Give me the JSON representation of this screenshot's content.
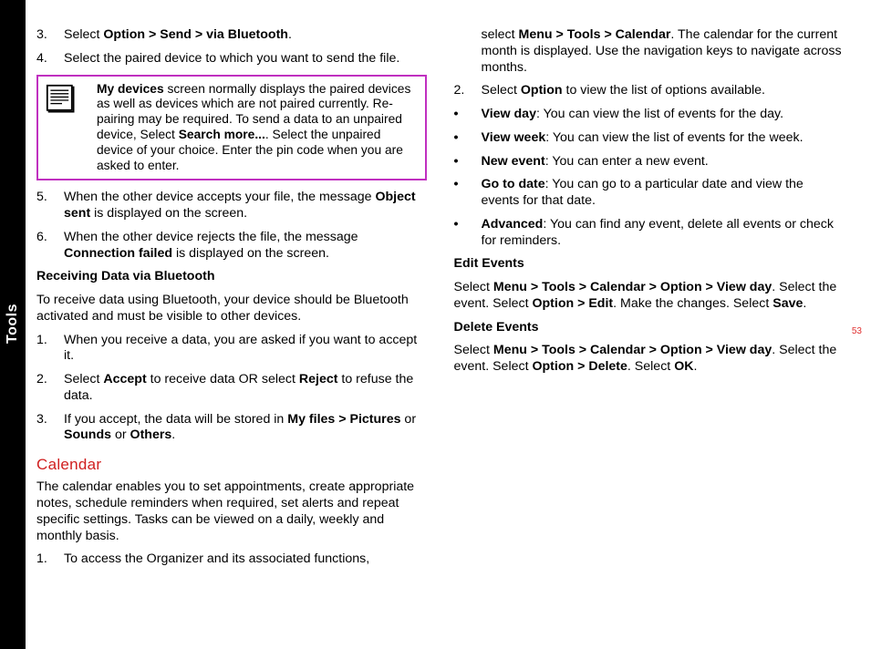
{
  "sideTab": "Tools",
  "pageNumber": "53",
  "col1": {
    "step3_num": "3.",
    "step3_a": "Select ",
    "step3_b": "Option > Send > via Bluetooth",
    "step3_c": ".",
    "step4_num": "4.",
    "step4": "Select the paired device to which you want to send the file.",
    "note_a": "My devices",
    "note_b": " screen normally displays the paired devices as well as devices which are not paired currently. Re-pairing may be required. To send a data to an unpaired device, Select ",
    "note_c": "Search more...",
    "note_d": ". Select the unpaired device of your choice. Enter the pin code when you are asked to enter.",
    "step5_num": "5.",
    "step5_a": "When the other device accepts your file, the message ",
    "step5_b": "Object sent",
    "step5_c": " is displayed on the screen.",
    "step6_num": "6.",
    "step6_a": "When the other device rejects the file, the message ",
    "step6_b": "Connection failed",
    "step6_c": " is displayed on the screen.",
    "recv_head": "Receiving Data via Bluetooth",
    "recv_intro": "To receive data using Bluetooth, your device should be Bluetooth activated and must be visible to other devices.",
    "r1_num": "1.",
    "r1": "When you receive a data, you are asked if you want to accept it.",
    "r2_num": "2.",
    "r2_a": "Select ",
    "r2_b": "Accept",
    "r2_c": " to receive data OR select ",
    "r2_d": "Reject",
    "r2_e": " to refuse the data.",
    "r3_num": "3.",
    "r3_a": "If you accept, the data will be stored in ",
    "r3_b": "My files > Pictures",
    "r3_c": " or ",
    "r3_d": "Sounds",
    "r3_e": " or ",
    "r3_f": "Others",
    "r3_g": ".",
    "cal_title": "Calendar",
    "cal_intro": "The calendar enables you to set appointments, create appropriate notes, schedule reminders when required, set alerts and repeat specific settings. Tasks can be viewed on a daily, weekly and monthly basis.",
    "c1_num": "1.",
    "c1": "To access the Organizer and its associated functions,"
  },
  "col2": {
    "cont_a": "select ",
    "cont_b": "Menu > Tools > Calendar",
    "cont_c": ". The calendar for the current month is displayed. Use the navigation keys to navigate across months.",
    "c2_num": "2.",
    "c2_a": "Select ",
    "c2_b": "Option",
    "c2_c": " to view the list of options available.",
    "b1_a": "View day",
    "b1_b": ": You can view the list of events for the day.",
    "b2_a": "View week",
    "b2_b": ": You can view the list of events for the week.",
    "b3_a": "New event",
    "b3_b": ": You can enter a new event.",
    "b4_a": "Go to date",
    "b4_b": ": You can go to a particular date and view the events for that date.",
    "b5_a": "Advanced",
    "b5_b": ": You can find any event, delete all events or check for reminders.",
    "edit_head": "Edit Events",
    "edit_a": "Select ",
    "edit_b": "Menu > Tools > Calendar > Option > View day",
    "edit_c": ". Select the event. Select ",
    "edit_d": "Option > Edit",
    "edit_e": ". Make the changes. Select ",
    "edit_f": "Save",
    "edit_g": ".",
    "del_head": "Delete Events",
    "del_a": "Select ",
    "del_b": "Menu > Tools > Calendar > Option > View day",
    "del_c": ". Select the event. Select ",
    "del_d": "Option > Delete",
    "del_e": ".  Select ",
    "del_f": "OK",
    "del_g": "."
  }
}
